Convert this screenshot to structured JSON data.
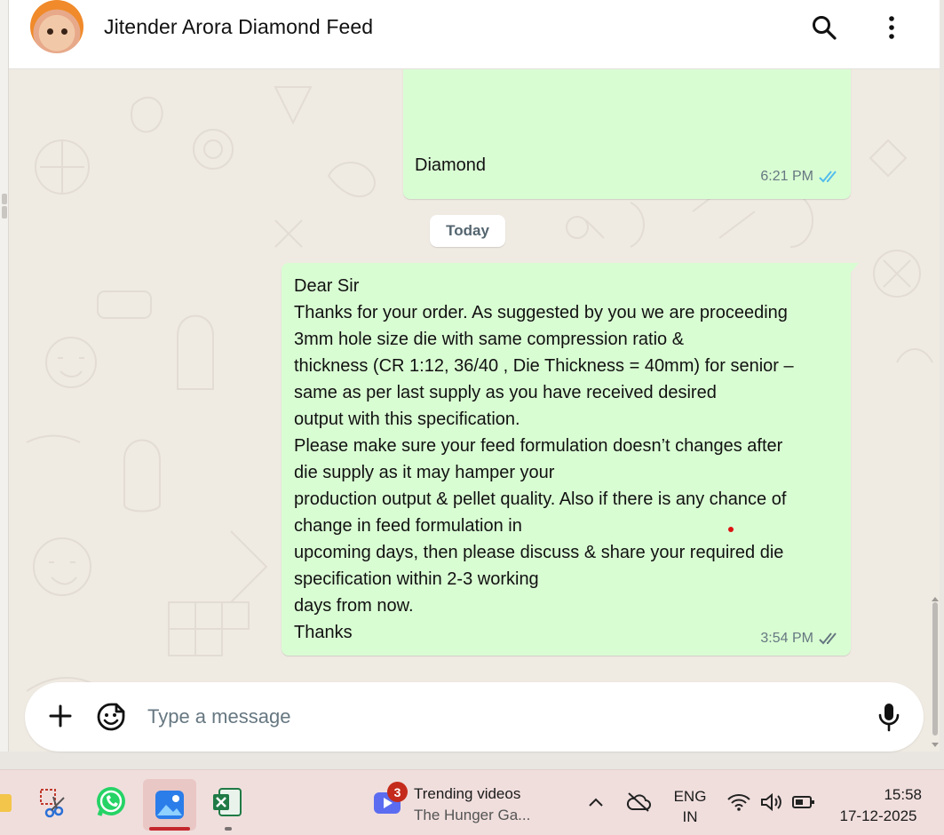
{
  "header": {
    "contact_name": "Jitender Arora Diamond Feed"
  },
  "messages": [
    {
      "text": "Diamond",
      "time": "6:21 PM",
      "status": "read"
    },
    {
      "text": "Dear Sir\nThanks for your order. As suggested by you we are proceeding\n3mm hole size die with same compression ratio &\nthickness (CR 1:12, 36/40  , Die Thickness = 40mm)  for senior –\nsame as per last supply as you have received desired\noutput with this specification.\nPlease make sure your feed formulation doesn’t changes after\ndie supply as it may hamper your\nproduction output & pellet quality. Also if there is any chance of\nchange in feed formulation in\nupcoming days, then please discuss & share your required die\nspecification within 2-3 working\ndays from now.\nThanks",
      "time": "3:54 PM",
      "status": "delivered"
    }
  ],
  "date_separator": "Today",
  "composer": {
    "placeholder": "Type a message"
  },
  "taskbar": {
    "notification_count": "3",
    "widget_title": "Trending videos",
    "widget_subtitle": "The Hunger Ga...",
    "lang_top": "ENG",
    "lang_bottom": "IN",
    "time": "15:58",
    "date": "17-12-2025"
  },
  "colors": {
    "bubble_out": "#d9fdd3",
    "chat_bg": "#efeae2",
    "read_ticks": "#53bdeb",
    "taskbar_bg": "#f0dedd"
  }
}
